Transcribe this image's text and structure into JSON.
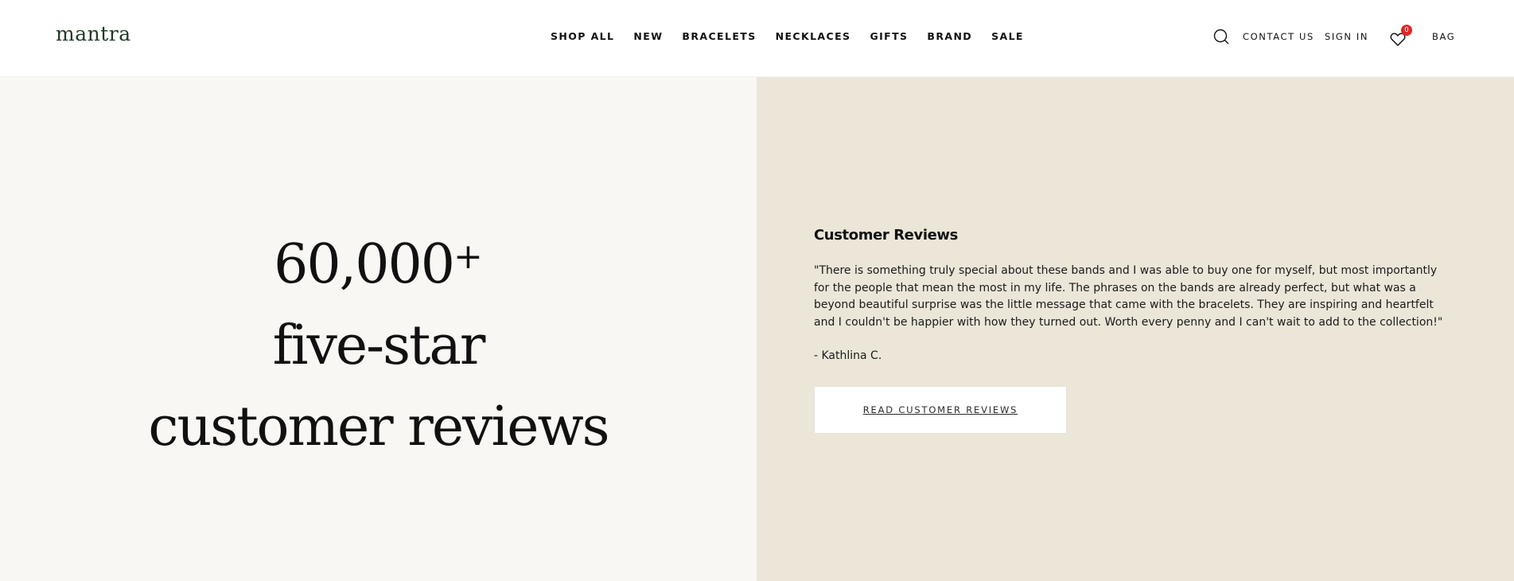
{
  "header": {
    "logo": "mantra",
    "nav": [
      "SHOP ALL",
      "NEW",
      "BRACELETS",
      "NECKLACES",
      "GIFTS",
      "BRAND",
      "SALE"
    ],
    "search_icon": "search-icon",
    "contact": "CONTACT US",
    "sign_in": "SIGN IN",
    "wishlist_icon": "heart-icon",
    "wishlist_count": "0",
    "bag": "BAG"
  },
  "hero": {
    "line1": "60,000",
    "line1_plus": "+",
    "line2": "five-star",
    "line3": "customer reviews"
  },
  "reviews": {
    "title": "Customer Reviews",
    "quote": "\"There is something truly special about these bands and I was able to buy one for myself, but most importantly for the people that mean the most in my life. The phrases on the bands are already perfect, but what was a beyond beautiful surprise was the little message that came with the bracelets. They are inspiring and heartfelt and I couldn't be happier with how they turned out. Worth every penny and I can't wait to add to the collection!\"",
    "author": "- Kathlina C.",
    "button": "READ CUSTOMER REVIEWS"
  },
  "colors": {
    "left_bg": "#f9f7f3",
    "right_bg": "#ece6d9",
    "badge": "#e0262a",
    "logo": "#1f3a24"
  }
}
